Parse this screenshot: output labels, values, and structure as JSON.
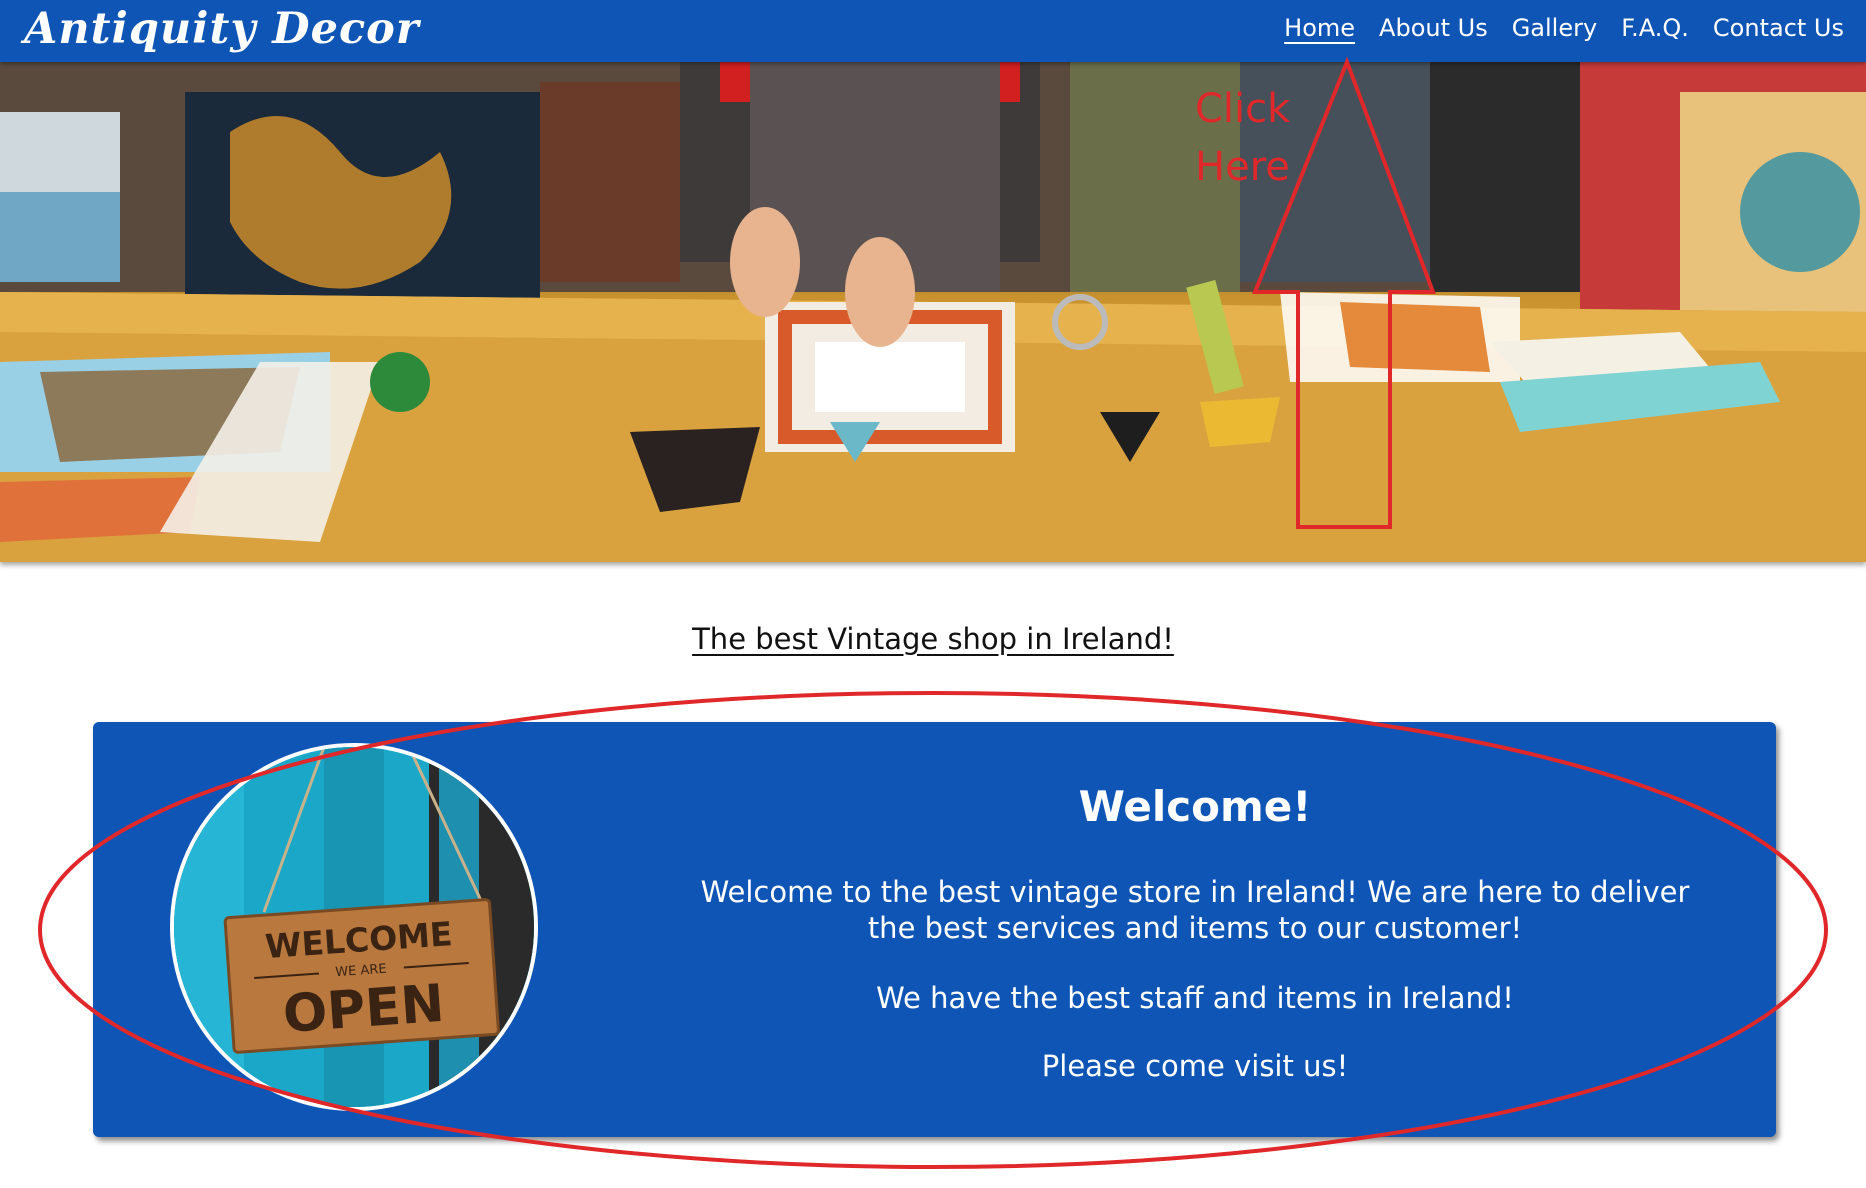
{
  "brand": {
    "logo": "Antiquity Decor"
  },
  "nav": {
    "items": [
      {
        "label": "Home",
        "active": true
      },
      {
        "label": "About Us",
        "active": false
      },
      {
        "label": "Gallery",
        "active": false
      },
      {
        "label": "F.A.Q.",
        "active": false
      },
      {
        "label": "Contact Us",
        "active": false
      }
    ]
  },
  "annotation": {
    "line1": "Click",
    "line2": "Here",
    "color": "#e0282a"
  },
  "tagline": "The best Vintage shop in Ireland!",
  "welcome": {
    "title": "Welcome!",
    "paragraphs": [
      "Welcome to the best vintage store in Ireland! We are here to deliver the best services and items to our customer!",
      "We have the best staff and items in Ireland!",
      "Please come visit us!"
    ],
    "sign_top": "WELCOME",
    "sign_mid": "WE ARE",
    "sign_bottom": "OPEN"
  },
  "colors": {
    "brand_blue": "#0f55b5"
  }
}
